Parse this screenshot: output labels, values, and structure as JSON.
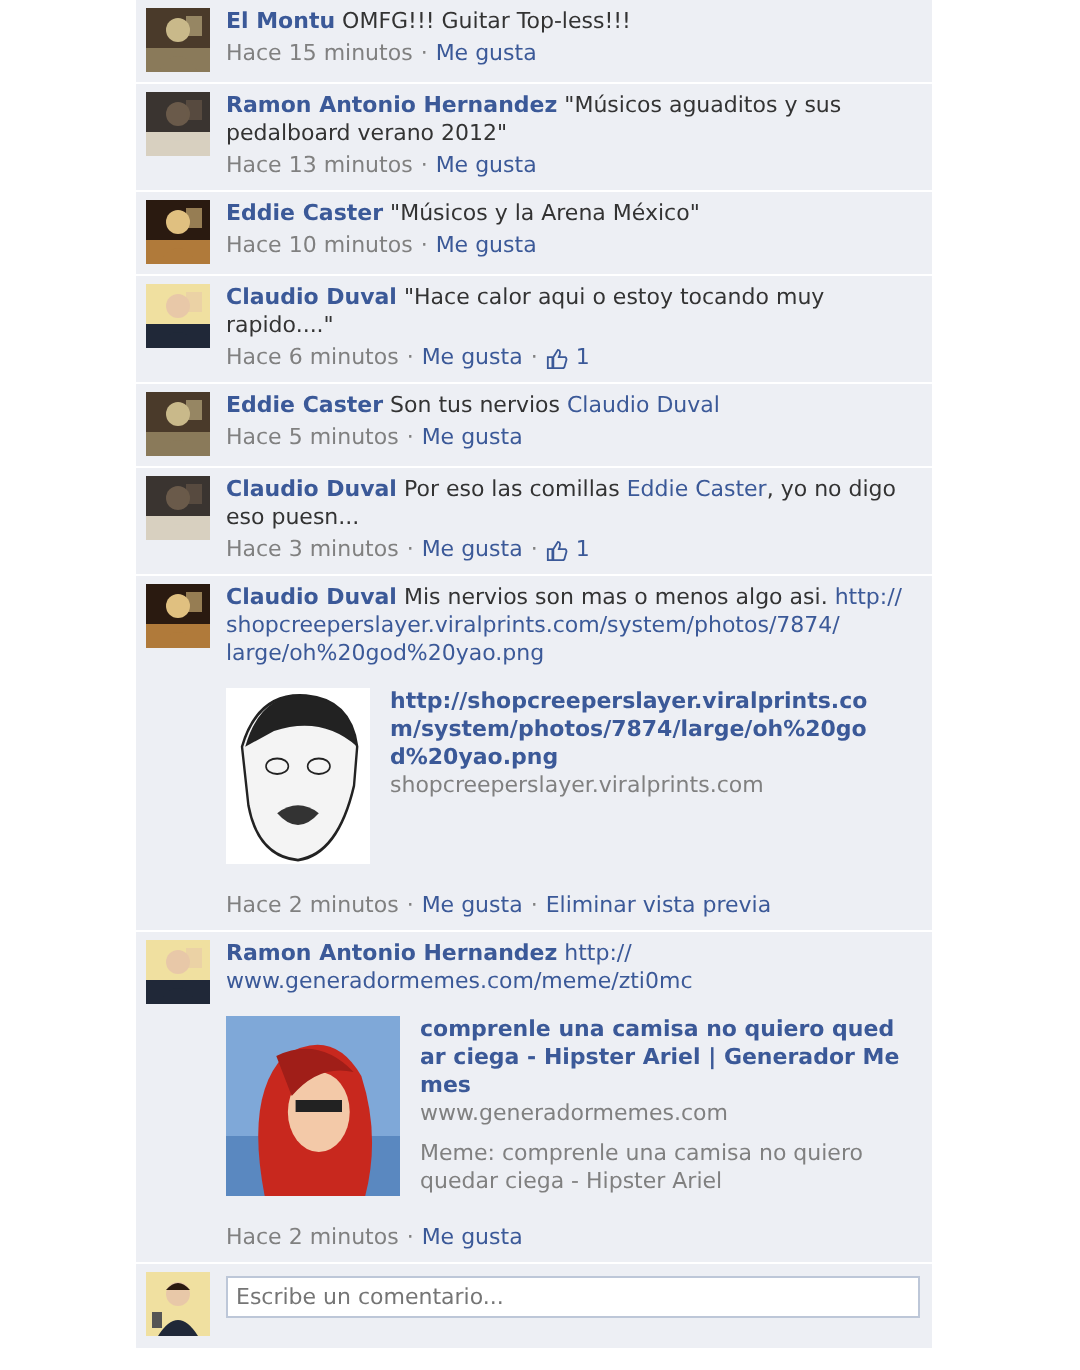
{
  "comments": [
    {
      "author": "El Montu",
      "body": [
        {
          "kind": "text",
          "text": "OMFG!!! Guitar Top-less!!!"
        }
      ],
      "meta": [
        {
          "kind": "time",
          "text": "Hace 15 minutos"
        },
        {
          "kind": "sep",
          "text": "·"
        },
        {
          "kind": "like",
          "text": "Me gusta"
        }
      ]
    },
    {
      "author": "Ramon Antonio Hernandez",
      "body": [
        {
          "kind": "text",
          "text": "\"Músicos aguaditos y sus pedalboard verano 2012\""
        }
      ],
      "meta": [
        {
          "kind": "time",
          "text": "Hace 13 minutos"
        },
        {
          "kind": "sep",
          "text": "·"
        },
        {
          "kind": "like",
          "text": "Me gusta"
        }
      ]
    },
    {
      "author": "Eddie Caster",
      "body": [
        {
          "kind": "text",
          "text": "\"Músicos y la Arena México\""
        }
      ],
      "meta": [
        {
          "kind": "time",
          "text": "Hace 10 minutos"
        },
        {
          "kind": "sep",
          "text": "·"
        },
        {
          "kind": "like",
          "text": "Me gusta"
        }
      ]
    },
    {
      "author": "Claudio Duval",
      "body": [
        {
          "kind": "text",
          "text": "\"Hace calor aqui o estoy tocando muy rapido....\""
        }
      ],
      "meta": [
        {
          "kind": "time",
          "text": "Hace 6 minutos"
        },
        {
          "kind": "sep",
          "text": "·"
        },
        {
          "kind": "like",
          "text": "Me gusta"
        },
        {
          "kind": "sep",
          "text": "·"
        },
        {
          "kind": "likes",
          "text": "1"
        }
      ]
    },
    {
      "author": "Eddie Caster",
      "body": [
        {
          "kind": "text",
          "text": "Son tus nervios "
        },
        {
          "kind": "mention",
          "text": "Claudio Duval"
        }
      ],
      "meta": [
        {
          "kind": "time",
          "text": "Hace 5 minutos"
        },
        {
          "kind": "sep",
          "text": "·"
        },
        {
          "kind": "like",
          "text": "Me gusta"
        }
      ]
    },
    {
      "author": "Claudio Duval",
      "body": [
        {
          "kind": "text",
          "text": "Por eso las comillas "
        },
        {
          "kind": "mention",
          "text": "Eddie Caster"
        },
        {
          "kind": "text",
          "text": ", yo no digo eso puesn..."
        }
      ],
      "meta": [
        {
          "kind": "time",
          "text": "Hace 3 minutos"
        },
        {
          "kind": "sep",
          "text": "·"
        },
        {
          "kind": "like",
          "text": "Me gusta"
        },
        {
          "kind": "sep",
          "text": "·"
        },
        {
          "kind": "likes",
          "text": "1"
        }
      ]
    },
    {
      "author": "Claudio Duval",
      "body": [
        {
          "kind": "text",
          "text": "Mis nervios son mas o menos algo asi. "
        },
        {
          "kind": "link",
          "text": "http://"
        },
        {
          "kind": "link",
          "text": "shopcreeperslayer.viralprints.com/system/photos/7874/"
        },
        {
          "kind": "link",
          "text": "large/oh%20god%20yao.png"
        }
      ],
      "preview": {
        "kind": "drawing",
        "title": "http://shopcreeperslayer.viralprints.com/system/photos/7874/large/oh%20god%20yao.png",
        "domain": "shopcreeperslayer.viralprints.com"
      },
      "meta": [
        {
          "kind": "time",
          "text": "Hace 2 minutos"
        },
        {
          "kind": "sep",
          "text": "·"
        },
        {
          "kind": "like",
          "text": "Me gusta"
        },
        {
          "kind": "sep",
          "text": "·"
        },
        {
          "kind": "remove",
          "text": "Eliminar vista previa"
        }
      ]
    },
    {
      "author": "Ramon Antonio Hernandez",
      "body": [
        {
          "kind": "link",
          "text": "http://"
        },
        {
          "kind": "link",
          "text": "www.generadormemes.com/meme/zti0mc"
        }
      ],
      "preview": {
        "kind": "picture",
        "title": "comprenle una camisa no quiero quedar ciega - Hipster Ariel | Generador Memes",
        "domain": "www.generadormemes.com",
        "description": "Meme: comprenle una camisa no quiero quedar ciega - Hipster Ariel"
      },
      "meta": [
        {
          "kind": "time",
          "text": "Hace 2 minutos"
        },
        {
          "kind": "sep",
          "text": "·"
        },
        {
          "kind": "like",
          "text": "Me gusta"
        }
      ]
    }
  ],
  "composer": {
    "placeholder": "Escribe un comentario..."
  }
}
